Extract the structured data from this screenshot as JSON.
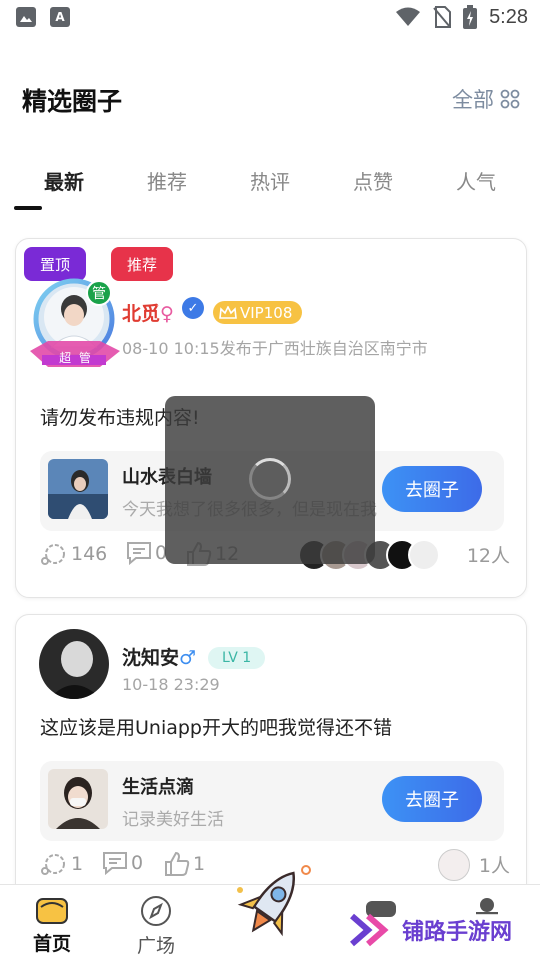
{
  "status_bar": {
    "time": "5:28"
  },
  "header": {
    "title": "精选圈子",
    "all_label": "全部"
  },
  "tabs": [
    {
      "label": "最新",
      "active": true
    },
    {
      "label": "推荐",
      "active": false
    },
    {
      "label": "热评",
      "active": false
    },
    {
      "label": "点赞",
      "active": false
    },
    {
      "label": "人气",
      "active": false
    }
  ],
  "posts": [
    {
      "tags": [
        "置顶",
        "推荐"
      ],
      "frame_badge": "管",
      "frame_ribbon": "超 管",
      "username": "北觅",
      "gender": "♀",
      "vip": "VIP108",
      "meta": "08-10 10:15发布于广西壮族自治区南宁市",
      "content": "请勿发布违规内容!",
      "circle": {
        "name": "山水表白墙",
        "desc": "今天我想了很多很多，但是现在我",
        "button": "去圈子"
      },
      "stats": {
        "comments": "146",
        "messages": "0",
        "likes": "12",
        "people": "12人"
      }
    },
    {
      "username": "沈知安",
      "gender": "♂",
      "level": "LV 1",
      "meta": "10-18 23:29",
      "content": "这应该是用Uniapp开大的吧我觉得还不错",
      "circle": {
        "name": "生活点滴",
        "desc": "记录美好生活",
        "button": "去圈子"
      },
      "stats": {
        "comments": "1",
        "messages": "0",
        "likes": "1",
        "people": "1人"
      }
    }
  ],
  "bottom_nav": [
    {
      "label": "首页",
      "active": true
    },
    {
      "label": "广场",
      "active": false
    }
  ],
  "watermark": "铺路手游网",
  "colors": {
    "accent_blue": "#3d7ae6",
    "tag_top": "#7a2ad6",
    "tag_rec": "#e7334a",
    "vip": "#f7c243"
  }
}
